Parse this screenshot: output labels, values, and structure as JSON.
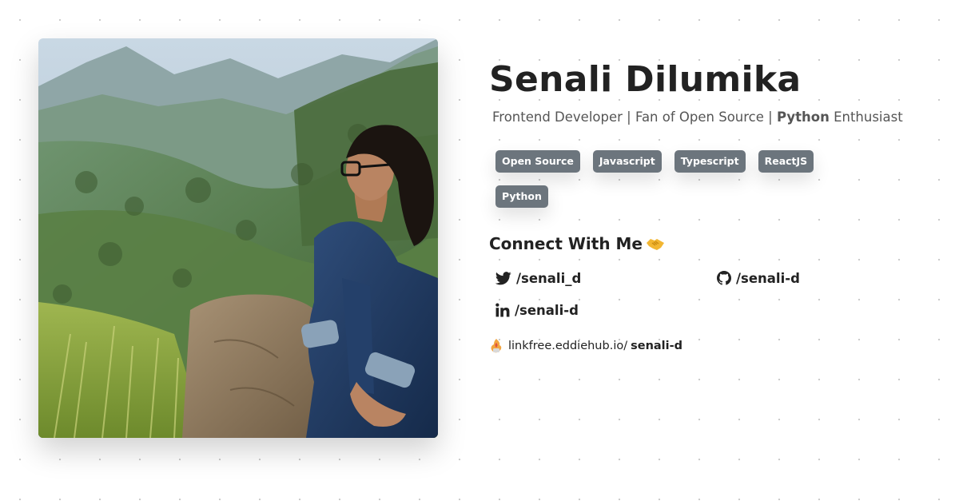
{
  "profile": {
    "name": "Senali Dilumika",
    "tagline_start": "Frontend Developer | Fan of Open Source | ",
    "tagline_bold": "Python",
    "tagline_end": " Enthusiast"
  },
  "tags": [
    "Open Source",
    "Javascript",
    "Typescript",
    "ReactJS",
    "Python"
  ],
  "connect": {
    "title": "Connect With Me",
    "twitter": "/senali_d",
    "github": "/senali-d",
    "linkedin": "/senali-d"
  },
  "linkfree": {
    "prefix": "linkfree.eddiehub.io/",
    "username": "senali-d"
  },
  "colors": {
    "tag_bg": "#6c757d",
    "text": "#222222",
    "muted": "#555555"
  }
}
